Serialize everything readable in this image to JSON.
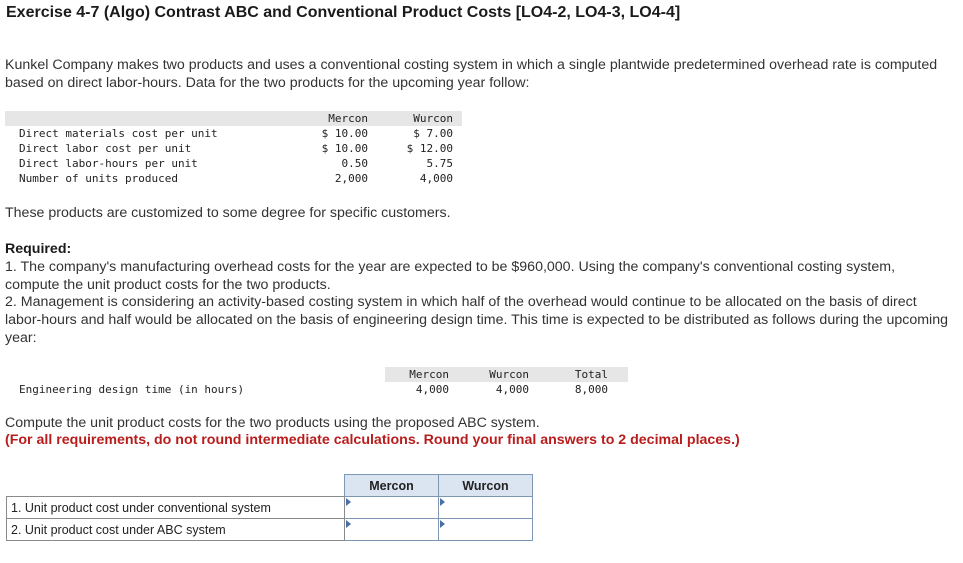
{
  "title": "Exercise 4-7 (Algo) Contrast ABC and Conventional Product Costs [LO4-2, LO4-3, LO4-4]",
  "intro": "Kunkel Company makes two products and uses a conventional costing system in which a single plantwide predetermined overhead rate is computed based on direct labor-hours. Data for the two products for the upcoming year follow:",
  "data_table": {
    "headers": [
      "Mercon",
      "Wurcon"
    ],
    "rows": [
      {
        "label": "Direct materials cost per unit",
        "mercon": "$ 10.00",
        "wurcon": "$ 7.00"
      },
      {
        "label": "Direct labor cost per unit",
        "mercon": "$ 10.00",
        "wurcon": "$ 12.00"
      },
      {
        "label": "Direct labor-hours per unit",
        "mercon": "0.50",
        "wurcon": "5.75"
      },
      {
        "label": "Number of units produced",
        "mercon": "2,000",
        "wurcon": "4,000"
      }
    ]
  },
  "customized": "These products are customized to some degree for specific customers.",
  "required_label": "Required:",
  "req1": "1. The company's manufacturing overhead costs for the year are expected to be $960,000. Using the company's conventional costing system, compute the unit product costs for the two products.",
  "req2": "2. Management is considering an activity-based costing system in which half of the overhead would continue to be allocated on the basis of direct labor-hours and half would be allocated on the basis of engineering design time. This time is expected to be distributed as follows during the upcoming year:",
  "eng_table": {
    "headers": [
      "Mercon",
      "Wurcon",
      "Total"
    ],
    "label": "Engineering design time (in hours)",
    "values": [
      "4,000",
      "4,000",
      "8,000"
    ]
  },
  "compute": "Compute the unit product costs for the two products using the proposed ABC system.",
  "instruction": "(For all requirements, do not round intermediate calculations. Round your final answers to 2 decimal places.)",
  "answer_table": {
    "headers": [
      "Mercon",
      "Wurcon"
    ],
    "rows": [
      {
        "label": "1. Unit product cost under conventional system"
      },
      {
        "label": "2. Unit product cost under ABC system"
      }
    ]
  }
}
